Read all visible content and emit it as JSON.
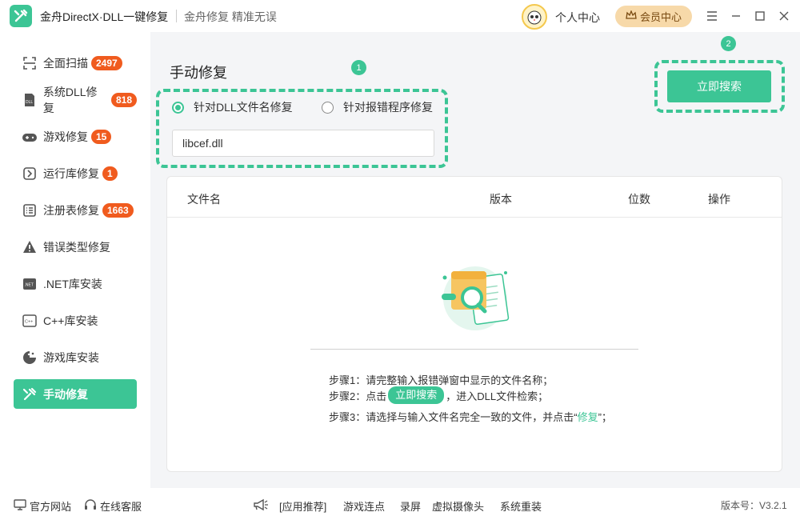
{
  "titlebar": {
    "app_title": "金舟DirectX·DLL一键修复",
    "slogan": "金舟修复 精准无误",
    "user_center": "个人中心",
    "vip_center": "会员中心"
  },
  "sidebar": {
    "items": [
      {
        "label": "全面扫描",
        "badge": "2497",
        "icon": "scan-icon"
      },
      {
        "label": "系统DLL修复",
        "badge": "818",
        "icon": "dll-icon"
      },
      {
        "label": "游戏修复",
        "badge": "15",
        "icon": "gamepad-icon"
      },
      {
        "label": "运行库修复",
        "badge": "1",
        "icon": "runtime-icon"
      },
      {
        "label": "注册表修复",
        "badge": "1663",
        "icon": "registry-icon"
      },
      {
        "label": "错误类型修复",
        "badge": "",
        "icon": "warning-icon"
      },
      {
        "label": ".NET库安装",
        "badge": "",
        "icon": "dotnet-icon"
      },
      {
        "label": "C++库安装",
        "badge": "",
        "icon": "cpp-icon"
      },
      {
        "label": "游戏库安装",
        "badge": "",
        "icon": "game-lib-icon"
      },
      {
        "label": "手动修复",
        "badge": "",
        "icon": "tools-icon"
      }
    ],
    "active_index": 9
  },
  "main": {
    "title": "手动修复",
    "step_markers": [
      "1",
      "2"
    ],
    "radio_options": [
      "针对DLL文件名修复",
      "针对报错程序修复"
    ],
    "selected_option": "针对DLL文件名修复",
    "input_value": "libcef.dll",
    "search_button": "立即搜索",
    "table_headers": [
      "文件名",
      "版本",
      "位数",
      "操作"
    ],
    "steps": {
      "step1": "步骤1：请完整输入报错弹窗中显示的文件名称；",
      "step2_prefix": "步骤2：点击",
      "step2_button": "立即搜索",
      "step2_suffix": "，进入DLL文件检索；",
      "step3_prefix": "步骤3：请选择与输入文件名完全一致的文件，并点击“",
      "step3_word": "修复",
      "step3_suffix": "”；"
    }
  },
  "footer": {
    "official_site": "官方网站",
    "online_service": "在线客服",
    "app_recommend": "[应用推荐]",
    "links": [
      "游戏连点",
      "录屏",
      "虚拟摄像头",
      "系统重装"
    ],
    "version": "版本号：V3.2.1"
  },
  "colors": {
    "accent": "#3cc595",
    "badge": "#f05b1e",
    "vip": "#f7d9a9"
  }
}
